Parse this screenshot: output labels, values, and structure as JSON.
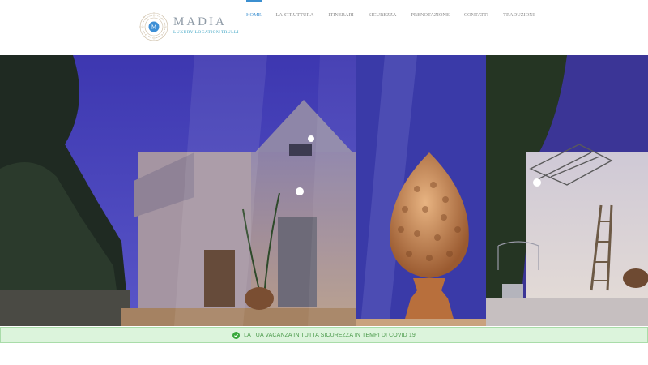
{
  "header": {
    "logo": {
      "monogram": "M",
      "name": "MADIA",
      "tagline": "LUXURY LOCATION TRULLI"
    },
    "nav": [
      {
        "label": "HOME",
        "active": true
      },
      {
        "label": "LA STRUTTURA",
        "active": false
      },
      {
        "label": "ITINERARI",
        "active": false
      },
      {
        "label": "SICUREZZA",
        "active": false
      },
      {
        "label": "PRENOTAZIONE",
        "active": false
      },
      {
        "label": "CONTATTI",
        "active": false
      },
      {
        "label": "TRADUZIONI",
        "active": false
      }
    ]
  },
  "banner": {
    "icon": "check-circle-icon",
    "text": "LA TUA VACANZA IN TUTTA SICUREZZA IN TEMPI DI COVID 19"
  },
  "colors": {
    "accent": "#3b8fd0",
    "banner_bg": "#dcf4dc",
    "banner_text": "#4b9a4b"
  }
}
